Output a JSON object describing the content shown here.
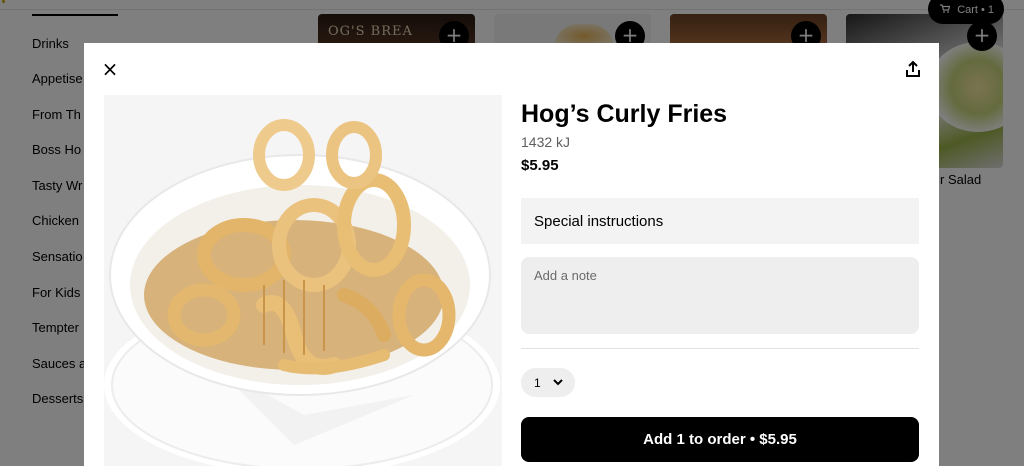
{
  "sidebar": {
    "items": [
      {
        "label": "Drinks"
      },
      {
        "label": "Appetise"
      },
      {
        "label": "From Th"
      },
      {
        "label": "Boss Ho"
      },
      {
        "label": "Tasty Wr"
      },
      {
        "label": "Chicken"
      },
      {
        "label": "Sensatio"
      },
      {
        "label": "For Kids"
      },
      {
        "label": "Tempter"
      },
      {
        "label": "Sauces a"
      },
      {
        "label": "Desserts"
      }
    ]
  },
  "menu": {
    "card1_brand": "OG'S BREA",
    "add_icon": "+",
    "salad_label": "r Salad"
  },
  "cart": {
    "icon": "cart-icon",
    "label": "Cart • 1"
  },
  "modal": {
    "close_icon": "×",
    "share_icon": "share-icon",
    "item": {
      "title": "Hog’s Curly Fries",
      "energy": "1432 kJ",
      "price": "$5.95"
    },
    "special_instructions": {
      "header": "Special instructions",
      "note_placeholder": "Add a note",
      "note_value": ""
    },
    "quantity": {
      "selected": "1"
    },
    "add_button": "Add 1 to order • $5.95"
  },
  "colors": {
    "primary": "#000000",
    "overlay": "rgba(0,0,0,0.5)",
    "field_background": "#eeeeee"
  }
}
